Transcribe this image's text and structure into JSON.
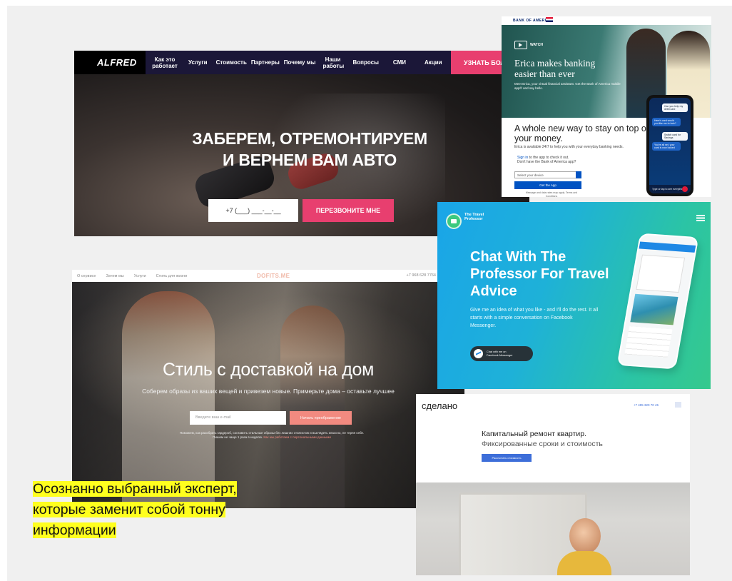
{
  "alfred": {
    "logo": "ALFRED",
    "nav": [
      "Как это работает",
      "Услуги",
      "Стоимость",
      "Партнеры",
      "Почему мы",
      "Наши работы",
      "Вопросы",
      "СМИ",
      "Акции"
    ],
    "cta": "УЗНАТЬ БОЛЬ",
    "title_line1": "ЗАБЕРЕМ, ОТРЕМОНТИРУЕМ",
    "title_line2": "И ВЕРНЕМ ВАМ АВТО",
    "phone_placeholder": "+7 (___) ___-__-__",
    "call_button": "ПЕРЕЗВОНИТЕ МНЕ",
    "accent": "#e83f6f"
  },
  "boa": {
    "logo": "BANK OF AMERICA",
    "watch": "WATCH",
    "hero_title": "Erica makes banking easier than ever",
    "hero_text": "Meet Erica, your virtual financial assistant. Get the Bank of America mobile app® and say hello.",
    "sub_title": "A whole new way to stay on top of your money.",
    "sub_text": "Erica is available 24/7 to help you with your everyday banking needs.",
    "sign_in": "Sign in",
    "sign_in_rest": " to the app to check it out.",
    "no_app": "Don't have the Bank of America app?",
    "select_placeholder": "Select your device",
    "get_app": "Get the App",
    "fine_print": "Message and data rates may apply. Terms and Conditions",
    "chat": [
      "Can you help my debit card",
      "Here's card would you like me to lock?",
      "Switch card for Savings",
      "You're all set, your card is now locked",
      "Type or tap to see everything"
    ],
    "brand": "#012169"
  },
  "dofits": {
    "nav": [
      "О сервисе",
      "Зачем мы",
      "Услуги",
      "Стиль для жизни"
    ],
    "logo": "DOFITS.ME",
    "phone": "+7 968 628 7764",
    "title": "Стиль с доставкой на дом",
    "subtitle": "Соберем образы из ваших вещей и привезем новые. Примерьте дома – оставьте лучшее",
    "email_placeholder": "Введите ваш e-mail",
    "button": "Начать преображение",
    "fine_print": "Поможем, как разобрать гардероб, составить стильные образы без лишних стилистов и выглядеть классно, не теряя себя. Пишем не чаще 1 раза в неделю.",
    "fine_link": "Как мы работаем с персональными данными",
    "accent": "#f28a80"
  },
  "travel": {
    "logo": "The Travel Professor",
    "title": "Chat With The Professor For Travel Advice",
    "text": "Give me an idea of what you like - and I'll do the rest. It all starts with a simple conversation on Facebook Messenger.",
    "fb_button_line1": "Chat with me on",
    "fb_button_line2": "Facebook Messenger"
  },
  "sdelano": {
    "logo": "сделано",
    "phone": "+7 495 320 70 45",
    "title": "Капитальный ремонт квартир.",
    "subtitle": "Фиксированные сроки и стоимость",
    "button": "Рассчитать стоимость",
    "accent": "#3d6ed9"
  },
  "caption": {
    "line1": "Осознанно выбранный эксперт,",
    "line2": "которые заменит собой тонну",
    "line3": "информации",
    "highlight": "#ffff1e"
  }
}
